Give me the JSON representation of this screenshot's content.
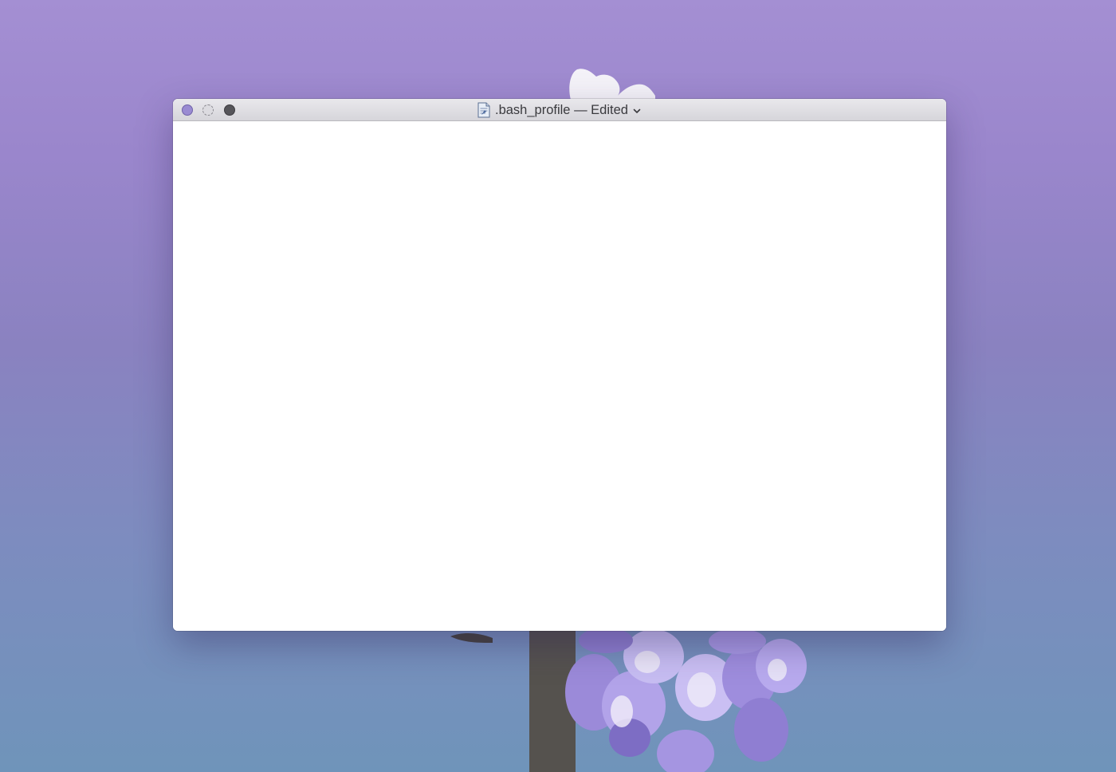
{
  "desktop": {
    "wallpaper": "purple-gradient-flower-wallpaper",
    "colors": {
      "top": "#a48fd3",
      "bottom": "#6f94ba",
      "flower": "#9d8be0",
      "stem": "#55524e"
    }
  },
  "window": {
    "title": ".bash_profile — Edited",
    "document_icon": "text-document-icon",
    "title_menu_icon": "chevron-down-icon",
    "buttons": {
      "close": "close-button",
      "minimize": "minimize-button",
      "zoom": "zoom-button"
    },
    "colors": {
      "close": "#9a8bd2",
      "titlebar": "#dcdbe0",
      "content": "#ffffff"
    },
    "content_text": ""
  }
}
